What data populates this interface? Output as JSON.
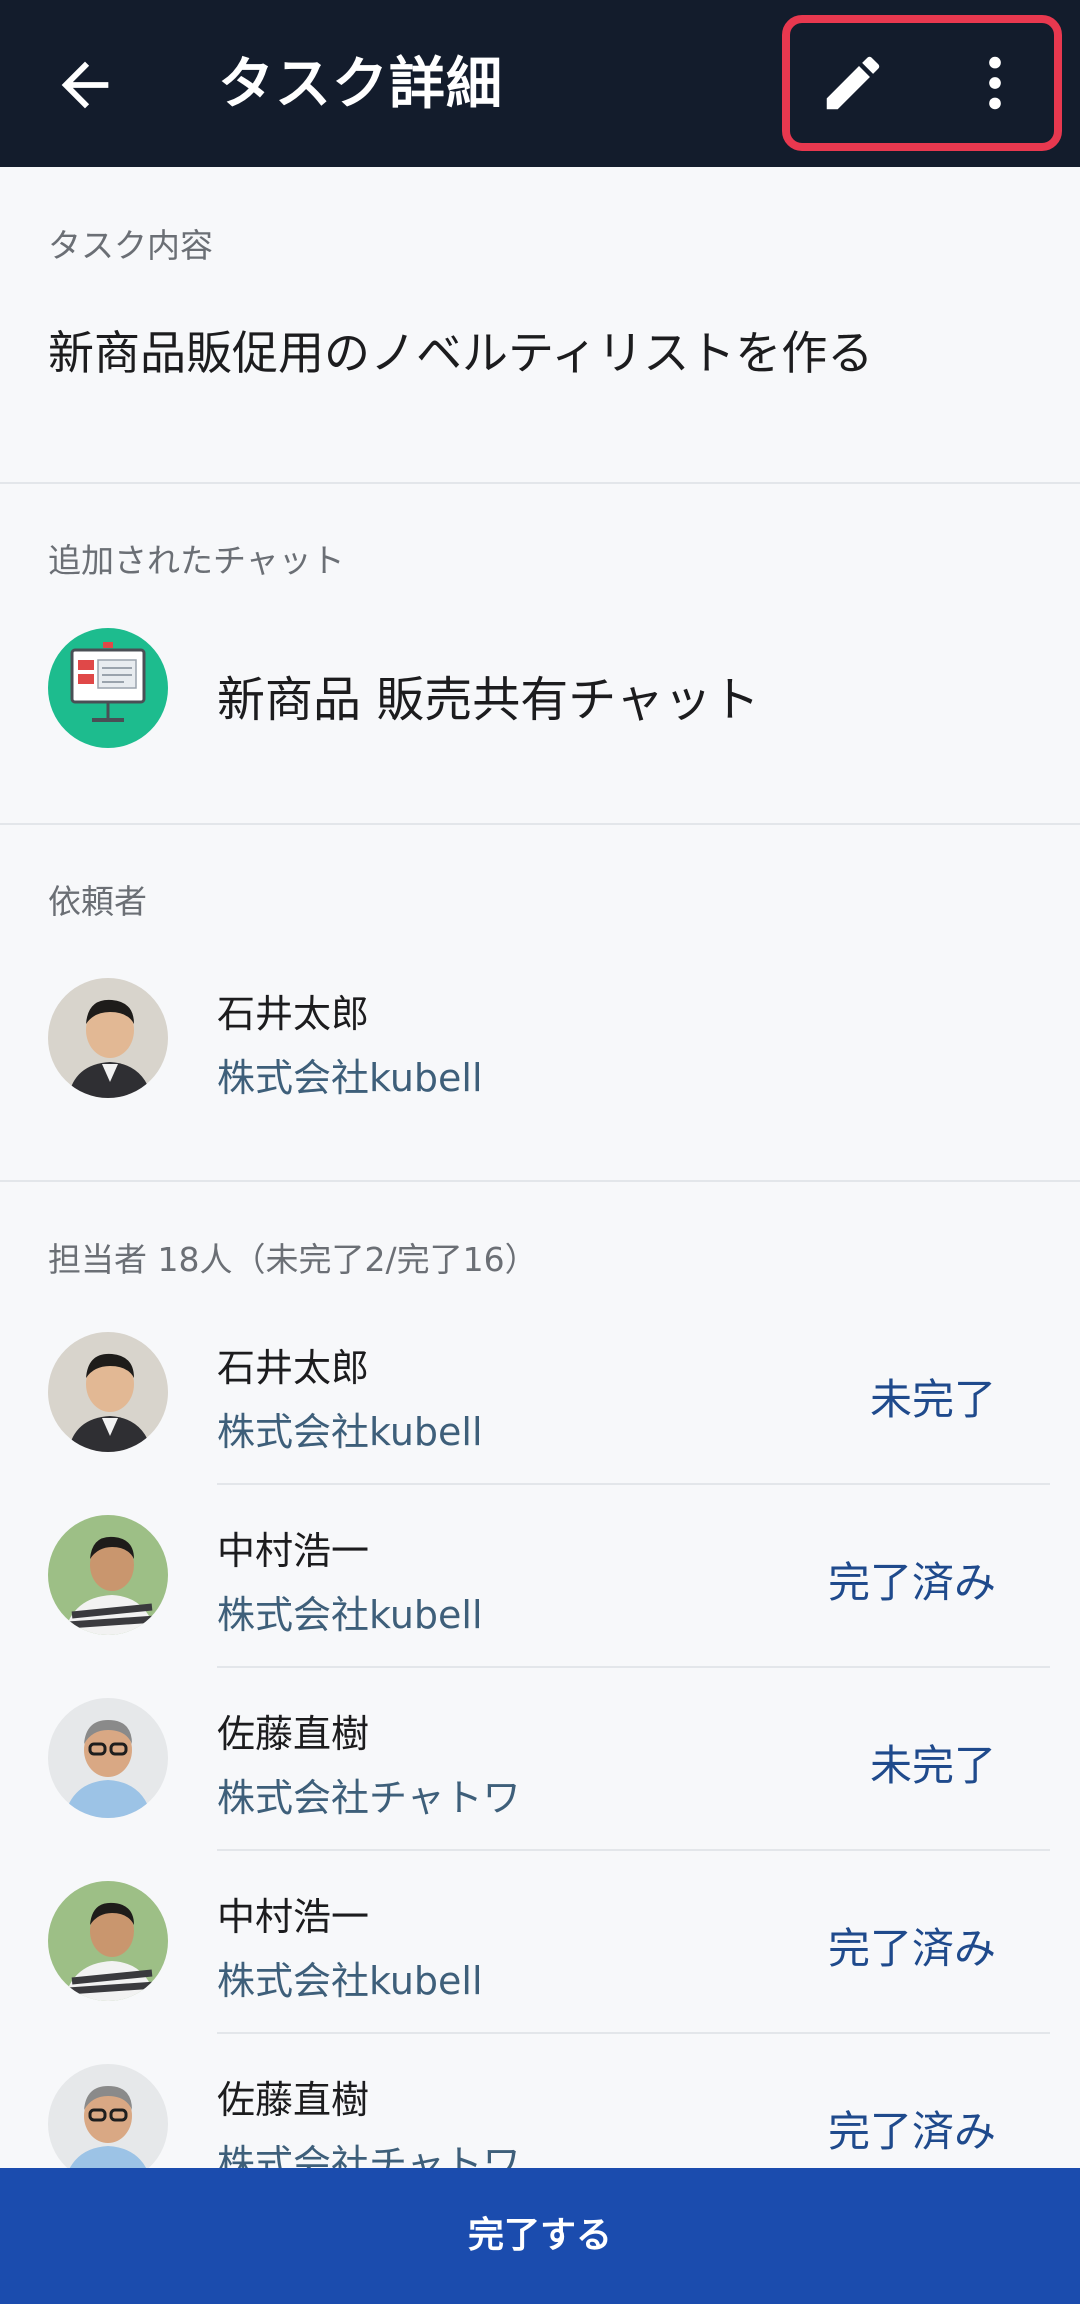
{
  "header": {
    "title": "タスク詳細",
    "back_icon": "arrow-left-icon",
    "edit_icon": "pencil-icon",
    "more_icon": "more-vertical-icon",
    "highlight_color": "#e8384f"
  },
  "task": {
    "label": "タスク内容",
    "content": "新商品販促用のノベルティリストを作る"
  },
  "chat": {
    "label": "追加されたチャット",
    "name": "新商品 販売共有チャット",
    "icon": "presentation-board-icon"
  },
  "requester": {
    "label": "依頼者",
    "name": "石井太郎",
    "company": "株式会社kubell"
  },
  "assignees": {
    "label": "担当者 18人（未完了2/完了16）",
    "items": [
      {
        "name": "石井太郎",
        "company": "株式会社kubell",
        "status": "未完了"
      },
      {
        "name": "中村浩一",
        "company": "株式会社kubell",
        "status": "完了済み"
      },
      {
        "name": "佐藤直樹",
        "company": "株式会社チャトワ",
        "status": "未完了"
      },
      {
        "name": "中村浩一",
        "company": "株式会社kubell",
        "status": "完了済み"
      },
      {
        "name": "佐藤直樹",
        "company": "株式会社チャトワ",
        "status": "完了済み"
      }
    ]
  },
  "footer": {
    "complete_label": "完了する"
  },
  "colors": {
    "header_bg": "#131c2c",
    "primary": "#1b4cae",
    "status_text": "#1f4a8c",
    "company_text": "#3e5f7a",
    "chat_icon_bg": "#1dbc8e"
  }
}
